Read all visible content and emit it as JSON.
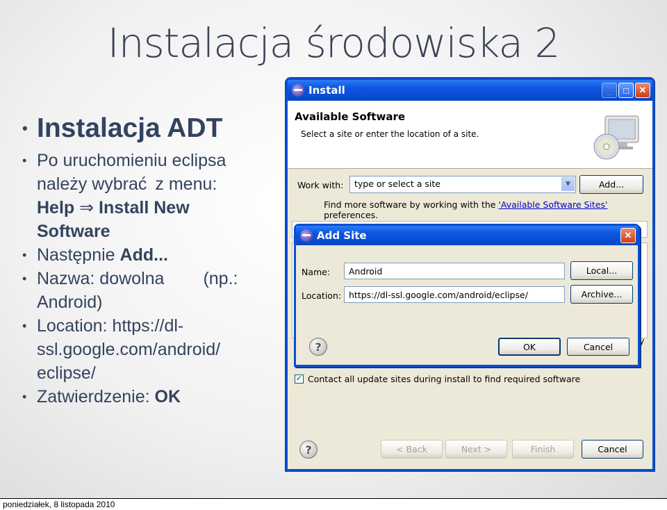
{
  "slide": {
    "title": "Instalacja środowiska 2",
    "bullets": {
      "b1": "Instalacja ADT",
      "b2_line1": "Po uruchomieniu eclipsa",
      "b2_line2a": "należy wybrać",
      "b2_line2b": "z menu:",
      "b2_line3a": "Help",
      "b2_arrow": "⇒",
      "b2_line3b": "Install New",
      "b2_line4": "Software",
      "b3_pre": "Następnie",
      "b3_bold": "Add...",
      "b4_line1a": "Nazwa: dowolna",
      "b4_line1b": "(np.:",
      "b4_line2": "Android)",
      "b5_line1": "Location: https://dl-",
      "b5_line2": "ssl.google.com/android/",
      "b5_line3": "eclipse/",
      "b6_pre": "Zatwierdzenie:",
      "b6_bold": "OK"
    }
  },
  "install_window": {
    "title": "Install",
    "header_title": "Available Software",
    "header_subtitle": "Select a site or enter the location of a site.",
    "work_with_label": "Work with:",
    "work_with_value": "type or select a site",
    "add_button": "Add...",
    "find_more_prefix": "Find more software by working with the ",
    "find_more_link": "'Available Software Sites'",
    "find_more_suffix": " preferences.",
    "partial_text": "y",
    "contact_all_label": "Contact all update sites during install to find required software",
    "contact_all_checked": true,
    "back_button": "< Back",
    "next_button": "Next >",
    "finish_button": "Finish",
    "cancel_button": "Cancel"
  },
  "add_site_dialog": {
    "title": "Add Site",
    "name_label": "Name:",
    "name_value": "Android",
    "location_label": "Location:",
    "location_value": "https://dl-ssl.google.com/android/eclipse/",
    "local_button": "Local...",
    "archive_button": "Archive...",
    "ok_button": "OK",
    "cancel_button": "Cancel"
  },
  "footer": {
    "date": "poniedziałek, 8 listopada 2010"
  },
  "colors": {
    "titlebar_blue": "#0a4fd0",
    "dialog_background": "#ece9d8",
    "slide_text": "#33435f"
  }
}
